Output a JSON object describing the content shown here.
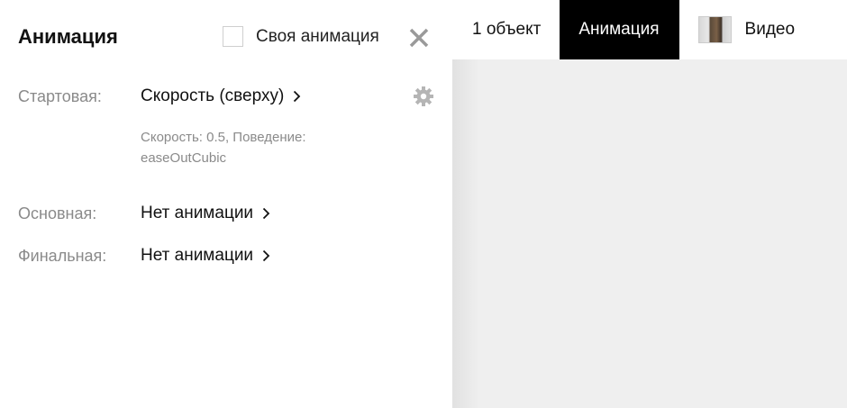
{
  "panel": {
    "title": "Анимация",
    "own_animation_label": "Своя анимация",
    "own_animation_checked": false
  },
  "rows": {
    "start": {
      "label": "Стартовая:",
      "value": "Скорость (сверху)",
      "details_line1": "Скорость: 0.5, Поведение:",
      "details_line2": "easeOutCubic"
    },
    "main": {
      "label": "Основная:",
      "value": "Нет анимации"
    },
    "final": {
      "label": "Финальная:",
      "value": "Нет анимации"
    }
  },
  "topbar": {
    "count_tab": "1 объект",
    "animation_tab": "Анимация",
    "video_tab": "Видео"
  },
  "icons": {
    "close": "close-icon",
    "gear": "gear-icon",
    "chevron": "chevron-right-icon",
    "thumbnail": "video-thumbnail"
  },
  "colors": {
    "active_tab_bg": "#000000",
    "workspace_bg": "#efefef",
    "muted_text": "#8a8a8a"
  }
}
